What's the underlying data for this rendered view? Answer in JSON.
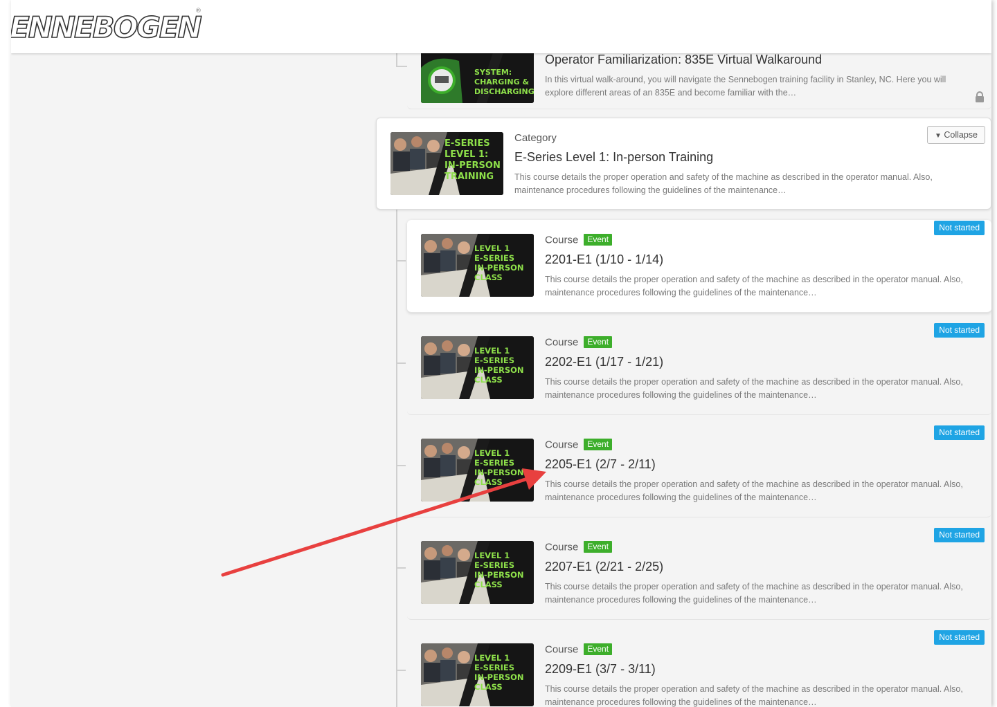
{
  "brand": {
    "logo_text": "ENNEBOGEN",
    "registered": "®"
  },
  "top_course": {
    "thumb_lines": [
      "SYSTEM:",
      "CHARGING &",
      "DISCHARGING"
    ],
    "title": "Operator Familiarization: 835E Virtual Walkaround",
    "description": "In this virtual walk-around, you will navigate the Sennebogen training facility in Stanley, NC. Here you will explore different areas of an 835E and become familiar with the…",
    "icon": "lock-icon"
  },
  "category": {
    "label": "Category",
    "title": "E-Series Level 1: In-person Training",
    "description": "This course details the proper operation and safety of the machine as described in the operator manual. Also, maintenance procedures following the guidelines of the maintenance…",
    "collapse_label": "Collapse",
    "collapse_icon": "chevron-down-icon",
    "thumb_lines": [
      "E-SERIES",
      "LEVEL 1:",
      "IN-PERSON",
      "TRAINING"
    ]
  },
  "courses": [
    {
      "type_label": "Course",
      "badge": "Event",
      "title": "2201-E1 (1/10 - 1/14)",
      "description": "This course details the proper operation and safety of the machine as described in the operator manual. Also, maintenance procedures following the guidelines of the maintenance…",
      "status": "Not started",
      "thumb_lines": [
        "LEVEL 1",
        "E-SERIES",
        "IN-PERSON",
        "CLASS"
      ]
    },
    {
      "type_label": "Course",
      "badge": "Event",
      "title": "2202-E1 (1/17 - 1/21)",
      "description": "This course details the proper operation and safety of the machine as described in the operator manual. Also, maintenance procedures following the guidelines of the maintenance…",
      "status": "Not started",
      "thumb_lines": [
        "LEVEL 1",
        "E-SERIES",
        "IN-PERSON",
        "CLASS"
      ]
    },
    {
      "type_label": "Course",
      "badge": "Event",
      "title": "2205-E1 (2/7 - 2/11)",
      "description": "This course details the proper operation and safety of the machine as described in the operator manual. Also, maintenance procedures following the guidelines of the maintenance…",
      "status": "Not started",
      "thumb_lines": [
        "LEVEL 1",
        "E-SERIES",
        "IN-PERSON",
        "CLASS"
      ]
    },
    {
      "type_label": "Course",
      "badge": "Event",
      "title": "2207-E1 (2/21 - 2/25)",
      "description": "This course details the proper operation and safety of the machine as described in the operator manual. Also, maintenance procedures following the guidelines of the maintenance…",
      "status": "Not started",
      "thumb_lines": [
        "LEVEL 1",
        "E-SERIES",
        "IN-PERSON",
        "CLASS"
      ]
    },
    {
      "type_label": "Course",
      "badge": "Event",
      "title": "2209-E1 (3/7 - 3/11)",
      "description": "This course details the proper operation and safety of the machine as described in the operator manual. Also, maintenance procedures following the guidelines of the maintenance…",
      "status": "Not started",
      "thumb_lines": [
        "LEVEL 1",
        "E-SERIES",
        "IN-PERSON",
        "CLASS"
      ]
    }
  ],
  "colors": {
    "status_badge": "#1fa4e4",
    "event_badge": "#3dae2b",
    "thumb_text": "#8ee04a",
    "annotation_arrow": "#e8403f"
  }
}
